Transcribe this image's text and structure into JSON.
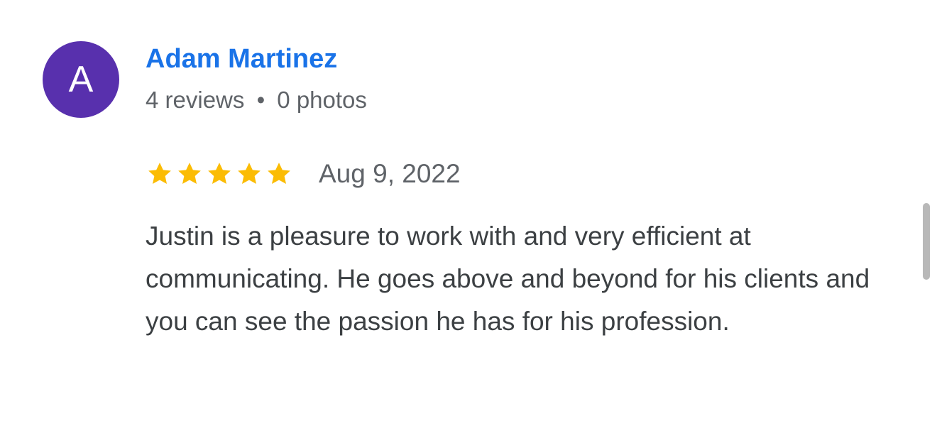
{
  "reviewer": {
    "initial": "A",
    "avatar_color": "#5830ad",
    "name": "Adam Martinez",
    "name_color": "#1a73e8",
    "reviews": "4 reviews",
    "separator": "•",
    "photos": "0 photos"
  },
  "review": {
    "rating": 5,
    "max_rating": 5,
    "star_color": "#fbbc04",
    "date": "Aug 9, 2022",
    "text": "Justin is a pleasure to work with and very efficient at communicating. He goes above and beyond for his clients and you can see the passion he has for his profession."
  }
}
